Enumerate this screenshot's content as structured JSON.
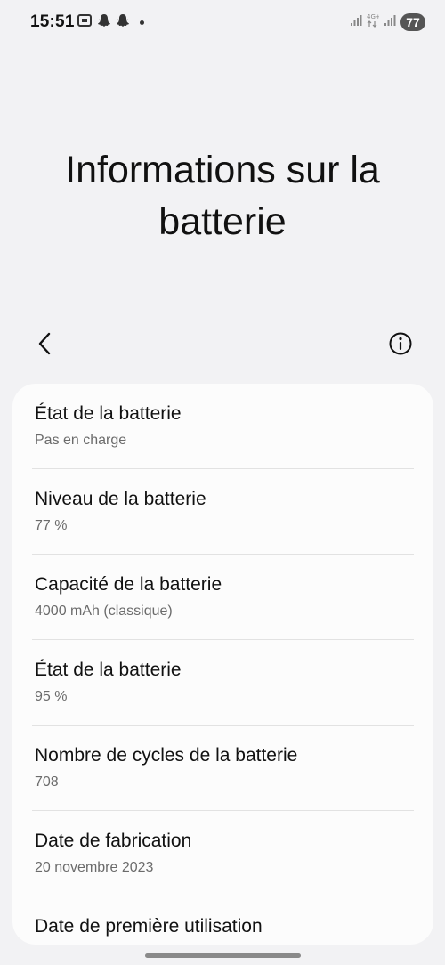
{
  "status_bar": {
    "time": "15:51",
    "battery": "77"
  },
  "page": {
    "title_line1": "Informations sur la",
    "title_line2": "batterie"
  },
  "items": [
    {
      "title": "État de la batterie",
      "value": "Pas en charge"
    },
    {
      "title": "Niveau de la batterie",
      "value": "77 %"
    },
    {
      "title": "Capacité de la batterie",
      "value": "4000 mAh (classique)"
    },
    {
      "title": "État de la batterie",
      "value": "95 %"
    },
    {
      "title": "Nombre de cycles de la batterie",
      "value": "708"
    },
    {
      "title": "Date de fabrication",
      "value": "20 novembre 2023"
    },
    {
      "title": "Date de première utilisation",
      "value": ""
    }
  ]
}
